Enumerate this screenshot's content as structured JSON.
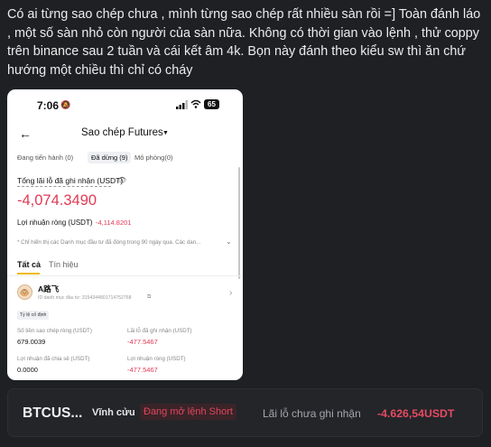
{
  "post": {
    "text": "Có ai từng sao chép chưa , mình từng sao chép rất nhiều sàn rồi =] Toàn đánh láo , một số sàn nhỏ còn người của sàn nữa. Không có thời gian vào lệnh , thử coppy trên binance sau 2 tuần và cái kết âm 4k. Bọn này đánh theo kiểu sw thì ăn chứ hướng một chiều thì chỉ có cháy"
  },
  "phone": {
    "status": {
      "time": "7:06",
      "battery": "65"
    },
    "title": "Sao chép Futures",
    "subtabs": [
      "Đang tiến hành (0)",
      "Đã dừng (9)",
      "Mô phỏng(0)"
    ],
    "pnl_label": "Tổng lãi lỗ đã ghi nhận (USDT)",
    "pnl_value": "-4,074.3490",
    "net_label": "Lợi nhuận ròng (USDT)",
    "net_value": "-4,114.8201",
    "note": "* Chỉ hiển thị các Danh mục đầu tư đã đóng trong 90 ngày qua. Các dan...",
    "tabs": [
      "Tất cả",
      "Tín hiệu"
    ],
    "trader": {
      "name": "A路飞",
      "id": "ID danh mục đầu tư: 3154344801714752768",
      "tag": "Tỷ lệ cố định"
    },
    "stats": [
      {
        "label": "Số tiền sao chép ròng (USDT)",
        "value": "679.0039"
      },
      {
        "label": "Lãi lỗ đã ghi nhận (USDT)",
        "value": "-477.5467"
      },
      {
        "label": "Lợi nhuận đã chia sẻ (USDT)",
        "value": "0.0000"
      },
      {
        "label": "Lợi nhuận ròng (USDT)",
        "value": "-477.5467"
      }
    ]
  },
  "position_bar": {
    "symbol": "BTCUS...",
    "type": "Vĩnh cửu",
    "badge": "Đang mở lệnh Short",
    "unrealized_label": "Lãi lỗ chưa ghi nhận",
    "unrealized_value": "-4.626,54USDT"
  },
  "colors": {
    "negative": "#e03a55",
    "accent": "#f0b90b",
    "background": "#1e2024"
  }
}
